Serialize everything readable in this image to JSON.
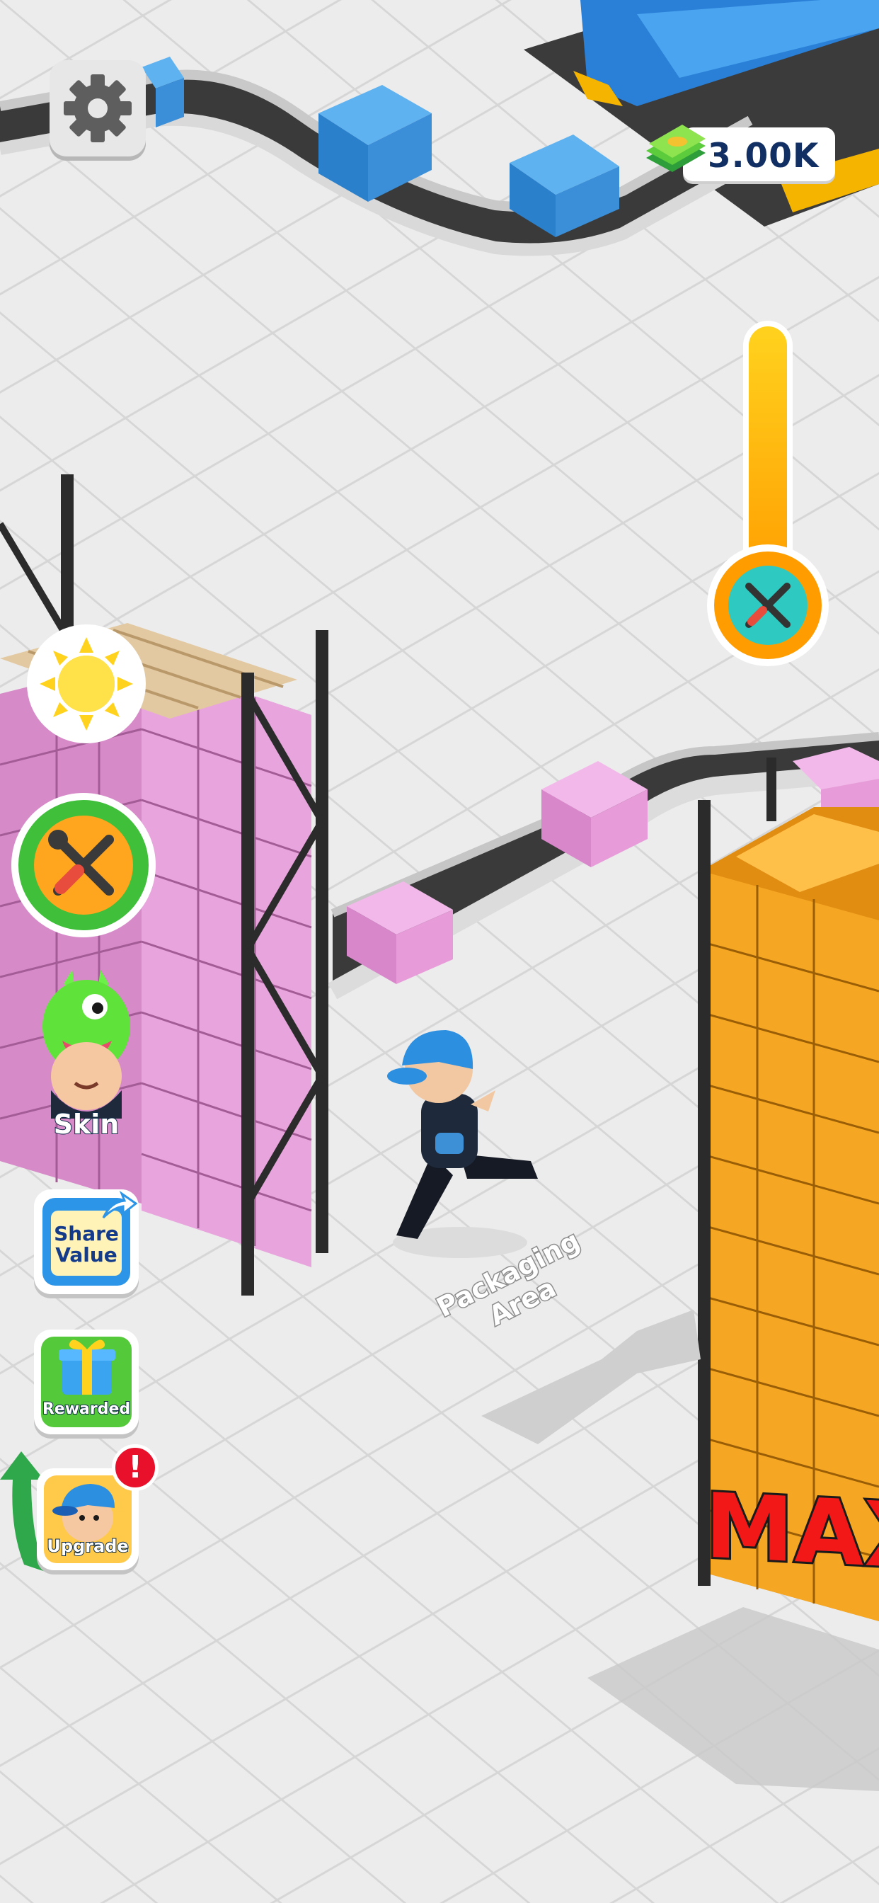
{
  "hud": {
    "cash_amount": "3.00K",
    "buttons": {
      "skin": "Skin",
      "share_value_line1": "Share",
      "share_value_line2": "Value",
      "rewarded": "Rewarded",
      "upgrade": "Upgrade",
      "notification_mark": "!"
    }
  },
  "world": {
    "area_label_line1": "Packaging",
    "area_label_line2": "Area",
    "stack_status": "MAX"
  },
  "icons": [
    "gear-icon",
    "cash-stack-icon",
    "sun-icon",
    "wrench-screwdriver-icon",
    "monster-hat-icon",
    "share-icon",
    "gift-icon",
    "upgrade-arrow-icon",
    "alert-icon"
  ],
  "colors": {
    "floor": "#e9e9e9",
    "pink_box": "#e79bd9",
    "orange_box": "#f5a623",
    "blue_box": "#3a8fd8",
    "max_text": "#f21818",
    "cash_text": "#122f63"
  }
}
